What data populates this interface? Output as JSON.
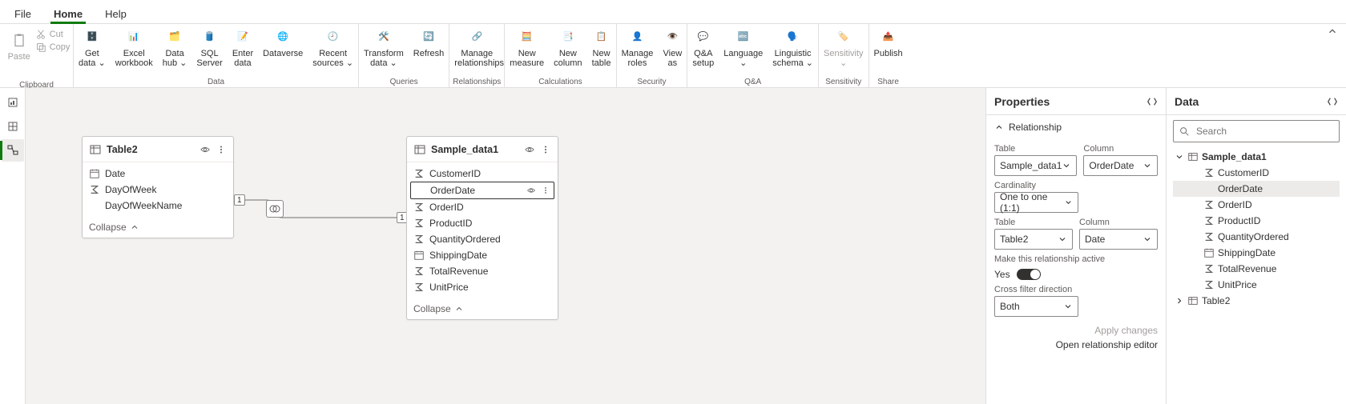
{
  "menu": {
    "tabs": [
      "File",
      "Home",
      "Help"
    ],
    "active": "Home"
  },
  "ribbon": {
    "clipboard": {
      "paste": "Paste",
      "cut": "Cut",
      "copy": "Copy",
      "label": "Clipboard"
    },
    "data_group": {
      "get_data": "Get\ndata ⌄",
      "excel": "Excel\nworkbook",
      "data_hub": "Data\nhub ⌄",
      "sql": "SQL\nServer",
      "enter": "Enter\ndata",
      "dataverse": "Dataverse",
      "recent": "Recent\nsources ⌄",
      "label": "Data"
    },
    "queries": {
      "transform": "Transform\ndata ⌄",
      "refresh": "Refresh",
      "label": "Queries"
    },
    "relationships": {
      "manage": "Manage\nrelationships",
      "label": "Relationships"
    },
    "calculations": {
      "measure": "New\nmeasure",
      "column": "New\ncolumn",
      "table": "New\ntable",
      "label": "Calculations"
    },
    "security": {
      "roles": "Manage\nroles",
      "view": "View\nas",
      "label": "Security"
    },
    "qa": {
      "setup": "Q&A\nsetup",
      "language": "Language\n⌄",
      "schema": "Linguistic\nschema ⌄",
      "label": "Q&A"
    },
    "sensitivity": {
      "btn": "Sensitivity\n⌄",
      "label": "Sensitivity"
    },
    "share": {
      "publish": "Publish",
      "label": "Share"
    }
  },
  "cards": {
    "table2": {
      "title": "Table2",
      "fields": [
        {
          "icon": "date",
          "name": "Date"
        },
        {
          "icon": "sigma",
          "name": "DayOfWeek"
        },
        {
          "icon": "none",
          "name": "DayOfWeekName"
        }
      ],
      "collapse": "Collapse"
    },
    "sample": {
      "title": "Sample_data1",
      "fields": [
        {
          "icon": "sigma",
          "name": "CustomerID"
        },
        {
          "icon": "none",
          "name": "OrderDate",
          "selected": true
        },
        {
          "icon": "sigma",
          "name": "OrderID"
        },
        {
          "icon": "sigma",
          "name": "ProductID"
        },
        {
          "icon": "sigma",
          "name": "QuantityOrdered"
        },
        {
          "icon": "date",
          "name": "ShippingDate"
        },
        {
          "icon": "sigma",
          "name": "TotalRevenue"
        },
        {
          "icon": "sigma",
          "name": "UnitPrice"
        }
      ],
      "collapse": "Collapse"
    },
    "badge1": "1",
    "badge2": "1"
  },
  "properties": {
    "title": "Properties",
    "section": "Relationship",
    "table_lbl": "Table",
    "column_lbl": "Column",
    "sel1_table": "Sample_data1",
    "sel1_col": "OrderDate",
    "cardinality_lbl": "Cardinality",
    "cardinality": "One to one (1:1)",
    "sel2_table": "Table2",
    "sel2_col": "Date",
    "active_lbl": "Make this relationship active",
    "active_val": "Yes",
    "filter_lbl": "Cross filter direction",
    "filter": "Both",
    "apply": "Apply changes",
    "open": "Open relationship editor"
  },
  "data": {
    "title": "Data",
    "search": "Search",
    "tree": {
      "t1": "Sample_data1",
      "fields": [
        "CustomerID",
        "OrderDate",
        "OrderID",
        "ProductID",
        "QuantityOrdered",
        "ShippingDate",
        "TotalRevenue",
        "UnitPrice"
      ],
      "icons": [
        "sigma",
        "none",
        "sigma",
        "sigma",
        "sigma",
        "date",
        "sigma",
        "sigma"
      ],
      "selected": "OrderDate",
      "t2": "Table2"
    }
  }
}
